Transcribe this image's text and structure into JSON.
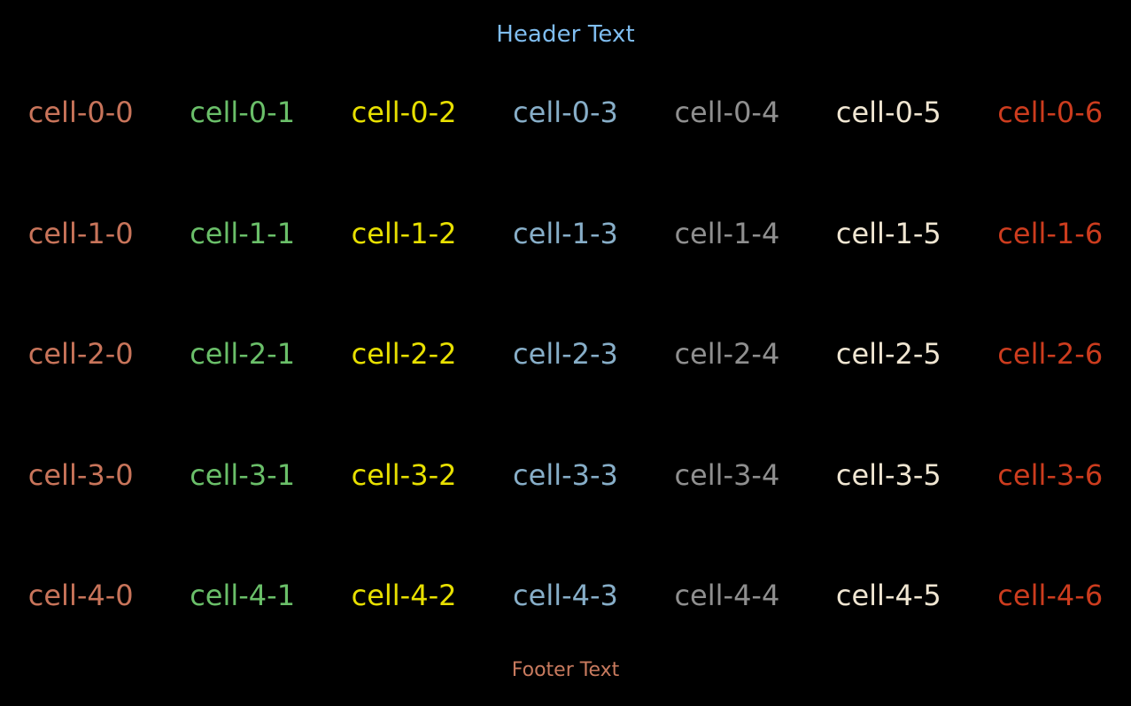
{
  "background_color": "#000000",
  "header": {
    "text": "Header Text",
    "color": "#7fbdf0"
  },
  "footer": {
    "text": "Footer Text",
    "color": "#c87a5e"
  },
  "grid": {
    "rows": 5,
    "columns": 7,
    "column_colors": [
      "#c8745a",
      "#6abf69",
      "#e8e000",
      "#87aec8",
      "#8f8f8f",
      "#f0e6d2",
      "#cc3c1e"
    ],
    "cells": [
      [
        {
          "label": "cell-0-0",
          "color": "#c8745a"
        },
        {
          "label": "cell-0-1",
          "color": "#6abf69"
        },
        {
          "label": "cell-0-2",
          "color": "#e8e000"
        },
        {
          "label": "cell-0-3",
          "color": "#87aec8"
        },
        {
          "label": "cell-0-4",
          "color": "#8f8f8f"
        },
        {
          "label": "cell-0-5",
          "color": "#f0e6d2"
        },
        {
          "label": "cell-0-6",
          "color": "#cc3c1e"
        }
      ],
      [
        {
          "label": "cell-1-0",
          "color": "#c8745a"
        },
        {
          "label": "cell-1-1",
          "color": "#6abf69"
        },
        {
          "label": "cell-1-2",
          "color": "#e8e000"
        },
        {
          "label": "cell-1-3",
          "color": "#87aec8"
        },
        {
          "label": "cell-1-4",
          "color": "#8f8f8f"
        },
        {
          "label": "cell-1-5",
          "color": "#f0e6d2"
        },
        {
          "label": "cell-1-6",
          "color": "#cc3c1e"
        }
      ],
      [
        {
          "label": "cell-2-0",
          "color": "#c8745a"
        },
        {
          "label": "cell-2-1",
          "color": "#6abf69"
        },
        {
          "label": "cell-2-2",
          "color": "#e8e000"
        },
        {
          "label": "cell-2-3",
          "color": "#87aec8"
        },
        {
          "label": "cell-2-4",
          "color": "#8f8f8f"
        },
        {
          "label": "cell-2-5",
          "color": "#f0e6d2"
        },
        {
          "label": "cell-2-6",
          "color": "#cc3c1e"
        }
      ],
      [
        {
          "label": "cell-3-0",
          "color": "#c8745a"
        },
        {
          "label": "cell-3-1",
          "color": "#6abf69"
        },
        {
          "label": "cell-3-2",
          "color": "#e8e000"
        },
        {
          "label": "cell-3-3",
          "color": "#87aec8"
        },
        {
          "label": "cell-3-4",
          "color": "#8f8f8f"
        },
        {
          "label": "cell-3-5",
          "color": "#f0e6d2"
        },
        {
          "label": "cell-3-6",
          "color": "#cc3c1e"
        }
      ],
      [
        {
          "label": "cell-4-0",
          "color": "#c8745a"
        },
        {
          "label": "cell-4-1",
          "color": "#6abf69"
        },
        {
          "label": "cell-4-2",
          "color": "#e8e000"
        },
        {
          "label": "cell-4-3",
          "color": "#87aec8"
        },
        {
          "label": "cell-4-4",
          "color": "#8f8f8f"
        },
        {
          "label": "cell-4-5",
          "color": "#f0e6d2"
        },
        {
          "label": "cell-4-6",
          "color": "#cc3c1e"
        }
      ]
    ]
  }
}
